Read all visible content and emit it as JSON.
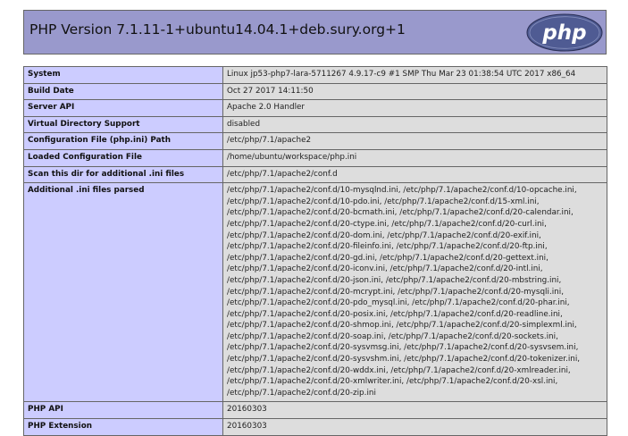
{
  "header": {
    "title": "PHP Version 7.1.11-1+ubuntu14.04.1+deb.sury.org+1",
    "logo_text": "php"
  },
  "rows": [
    {
      "label": "System",
      "value": "Linux jp53-php7-lara-5711267 4.9.17-c9 #1 SMP Thu Mar 23 01:38:54 UTC 2017 x86_64"
    },
    {
      "label": "Build Date",
      "value": "Oct 27 2017 14:11:50"
    },
    {
      "label": "Server API",
      "value": "Apache 2.0 Handler"
    },
    {
      "label": "Virtual Directory Support",
      "value": "disabled"
    },
    {
      "label": "Configuration File (php.ini) Path",
      "value": "/etc/php/7.1/apache2"
    },
    {
      "label": "Loaded Configuration File",
      "value": "/home/ubuntu/workspace/php.ini"
    },
    {
      "label": "Scan this dir for additional .ini files",
      "value": "/etc/php/7.1/apache2/conf.d"
    }
  ],
  "additional_ini": {
    "label": "Additional .ini files parsed",
    "lines": [
      "/etc/php/7.1/apache2/conf.d/10-mysqlnd.ini, /etc/php/7.1/apache2/conf.d/10-opcache.ini,",
      "/etc/php/7.1/apache2/conf.d/10-pdo.ini, /etc/php/7.1/apache2/conf.d/15-xml.ini,",
      "/etc/php/7.1/apache2/conf.d/20-bcmath.ini, /etc/php/7.1/apache2/conf.d/20-calendar.ini,",
      "/etc/php/7.1/apache2/conf.d/20-ctype.ini, /etc/php/7.1/apache2/conf.d/20-curl.ini,",
      "/etc/php/7.1/apache2/conf.d/20-dom.ini, /etc/php/7.1/apache2/conf.d/20-exif.ini,",
      "/etc/php/7.1/apache2/conf.d/20-fileinfo.ini, /etc/php/7.1/apache2/conf.d/20-ftp.ini,",
      "/etc/php/7.1/apache2/conf.d/20-gd.ini, /etc/php/7.1/apache2/conf.d/20-gettext.ini,",
      "/etc/php/7.1/apache2/conf.d/20-iconv.ini, /etc/php/7.1/apache2/conf.d/20-intl.ini,",
      "/etc/php/7.1/apache2/conf.d/20-json.ini, /etc/php/7.1/apache2/conf.d/20-mbstring.ini,",
      "/etc/php/7.1/apache2/conf.d/20-mcrypt.ini, /etc/php/7.1/apache2/conf.d/20-mysqli.ini,",
      "/etc/php/7.1/apache2/conf.d/20-pdo_mysql.ini, /etc/php/7.1/apache2/conf.d/20-phar.ini,",
      "/etc/php/7.1/apache2/conf.d/20-posix.ini, /etc/php/7.1/apache2/conf.d/20-readline.ini,",
      "/etc/php/7.1/apache2/conf.d/20-shmop.ini, /etc/php/7.1/apache2/conf.d/20-simplexml.ini,",
      "/etc/php/7.1/apache2/conf.d/20-soap.ini, /etc/php/7.1/apache2/conf.d/20-sockets.ini,",
      "/etc/php/7.1/apache2/conf.d/20-sysvmsg.ini, /etc/php/7.1/apache2/conf.d/20-sysvsem.ini,",
      "/etc/php/7.1/apache2/conf.d/20-sysvshm.ini, /etc/php/7.1/apache2/conf.d/20-tokenizer.ini,",
      "/etc/php/7.1/apache2/conf.d/20-wddx.ini, /etc/php/7.1/apache2/conf.d/20-xmlreader.ini,",
      "/etc/php/7.1/apache2/conf.d/20-xmlwriter.ini, /etc/php/7.1/apache2/conf.d/20-xsl.ini,",
      "/etc/php/7.1/apache2/conf.d/20-zip.ini"
    ]
  },
  "rows_after": [
    {
      "label": "PHP API",
      "value": "20160303"
    },
    {
      "label": "PHP Extension",
      "value": "20160303"
    }
  ],
  "colors": {
    "header_bg": "#9999cc",
    "label_bg": "#ccccff",
    "value_bg": "#dddddd",
    "border": "#666666",
    "logo_bg": "#4f5b93"
  }
}
